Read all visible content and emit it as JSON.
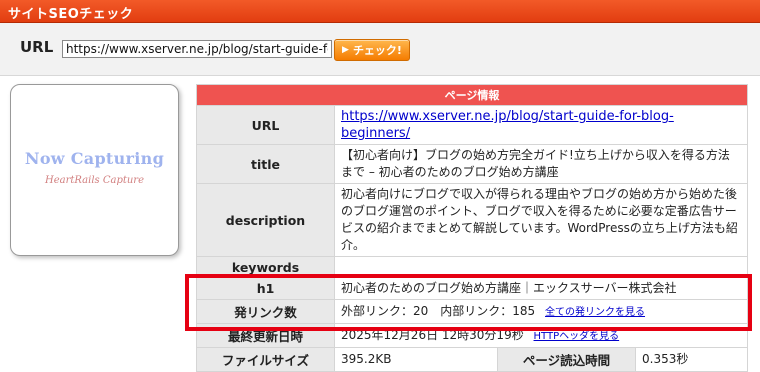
{
  "header": {
    "title": "サイトSEOチェック"
  },
  "url_bar": {
    "label": "URL",
    "value": "https://www.xserver.ne.jp/blog/start-guide-for-blog-beginners/",
    "button": "チェック!"
  },
  "thumbnail": {
    "line1": "Now Capturing",
    "line2": "HeartRails Capture"
  },
  "info_table": {
    "heading": "ページ情報",
    "url_label": "URL",
    "url_value": "https://www.xserver.ne.jp/blog/start-guide-for-blog-beginners/",
    "title_label": "title",
    "title_value": "【初心者向け】ブログの始め方完全ガイド!立ち上げから収入を得る方法まで – 初心者のためのブログ始め方講座",
    "description_label": "description",
    "description_value": "初心者向けにブログで収入が得られる理由やブログの始め方から始めた後のブログ運営のポイント、ブログで収入を得るために必要な定番広告サービスの紹介までまとめて解説しています。WordPressの立ち上げ方法も紹介。",
    "keywords_label": "keywords",
    "keywords_value": "",
    "h1_label": "h1",
    "h1_value": "初心者のためのブログ始め方講座｜エックスサーバー株式会社",
    "links_label": "発リンク数",
    "links_value": "外部リンク：20　内部リンク：185",
    "links_more": "全ての発リンクを見る",
    "updated_label": "最終更新日時",
    "updated_value": "2025年12月26日 12時30分19秒",
    "http_header_link": "HTTPヘッダを見る",
    "filesize_label": "ファイルサイズ",
    "filesize_value": "395.2KB",
    "loadtime_label": "ページ読込時間",
    "loadtime_value": "0.353秒"
  },
  "colors": {
    "title_bar": "#e8461a",
    "table_header": "#ef5350",
    "highlight_box": "#e60012",
    "check_button": "#f57c00"
  }
}
